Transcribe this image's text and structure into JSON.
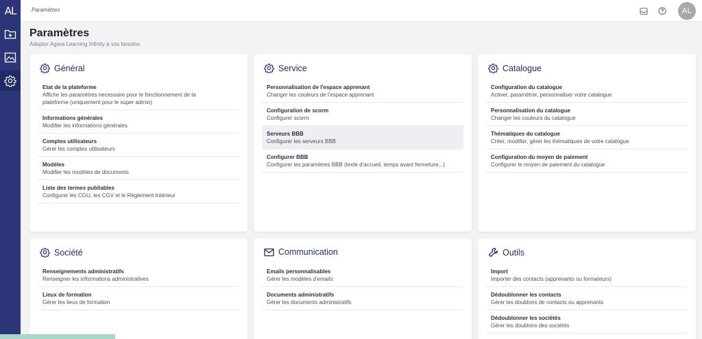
{
  "app": {
    "logo": "AL"
  },
  "sidebar": {
    "items": [
      {
        "icon": "folder-plus-icon"
      },
      {
        "icon": "chart-image-icon"
      },
      {
        "icon": "gear-icon",
        "active": true
      }
    ]
  },
  "topbar": {
    "breadcrumb": "Paramètres",
    "avatar_initials": "AL"
  },
  "page": {
    "title": "Paramètres",
    "subtitle": "Adapter Agora Learning Infinity à vos besoins"
  },
  "cards": {
    "general": {
      "title": "Général",
      "items": [
        {
          "title": "Etat de la plateforme",
          "desc": "Affiche les paramètres necessaire pour le fonctionnement de la\nplateforme (uniquement pour le super admin)"
        },
        {
          "title": "Informations générales",
          "desc": "Modifier les informations générales"
        },
        {
          "title": "Comptes utilisateurs",
          "desc": "Gérer les comptes utilisateurs"
        },
        {
          "title": "Modèles",
          "desc": "Modifier les modèles de documents"
        },
        {
          "title": "Liste des termes publiables",
          "desc": "Configurer les CGU, les CGV et le Règlement Intérieur"
        }
      ]
    },
    "service": {
      "title": "Service",
      "items": [
        {
          "title": "Personnalisation de l'espace apprenant",
          "desc": "Changer les couleurs de l'espace apprenant"
        },
        {
          "title": "Configuration de scorm",
          "desc": "Configurer scorm"
        },
        {
          "title": "Serveurs BBB",
          "desc": "Configurer les serveurs BBB",
          "highlighted": true
        },
        {
          "title": "Configurer BBB",
          "desc": "Configurer les paramètres BBB (texte d'accueil, temps avant fermeture...)"
        }
      ]
    },
    "catalogue": {
      "title": "Catalogue",
      "items": [
        {
          "title": "Configuration du catalogue",
          "desc": "Activer, paramétrer, personnaliser votre catalogue"
        },
        {
          "title": "Personnalisation du catalogue",
          "desc": "Changer les couleurs du catalogue"
        },
        {
          "title": "Thématiques du catalogue",
          "desc": "Créer, modifier, gérer les thématiques de votre catalogue"
        },
        {
          "title": "Configuration du moyen de paiement",
          "desc": "Configurer le moyen de paiement du catalogue"
        }
      ]
    },
    "societe": {
      "title": "Société",
      "items": [
        {
          "title": "Renseignements administratifs",
          "desc": "Renseigner les informations administratives"
        },
        {
          "title": "Lieux de formation",
          "desc": "Gérer les lieux de formation"
        }
      ]
    },
    "communication": {
      "title": "Communication",
      "items": [
        {
          "title": "Emails personnalisables",
          "desc": "Gérer les modèles d'emails"
        },
        {
          "title": "Documents administratifs",
          "desc": "Gérer les documents administratifs"
        }
      ]
    },
    "outils": {
      "title": "Outils",
      "items": [
        {
          "title": "Import",
          "desc": "Importer des contacts (apprenants ou formateurs)"
        },
        {
          "title": "Dédoublonner les contacts",
          "desc": "Gérer les doublons de contacts ou apprenants"
        },
        {
          "title": "Dédoublonner les sociétés",
          "desc": "Gérer les doublons des sociétés"
        }
      ]
    }
  },
  "colors": {
    "sidebar": "#2b3578",
    "accent": "#1f2a57",
    "background": "#f2f3f5"
  }
}
